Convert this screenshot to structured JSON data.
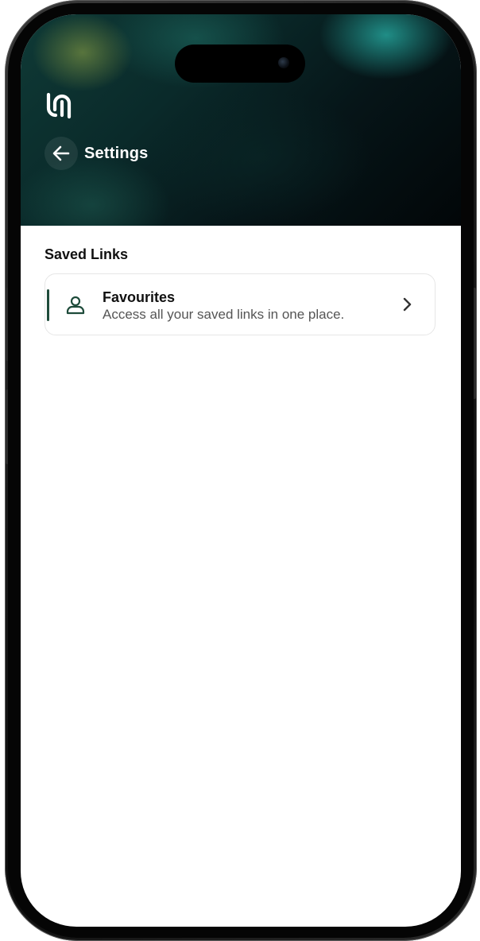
{
  "header": {
    "title": "Settings",
    "logo_icon": "app-logo-icon",
    "back_icon": "arrow-left-icon"
  },
  "section": {
    "title": "Saved Links"
  },
  "items": [
    {
      "title": "Favourites",
      "subtitle": "Access all your saved links in one place.",
      "icon": "user-icon",
      "trailing_icon": "chevron-right-icon"
    }
  ],
  "colors": {
    "accent": "#1e4b3a",
    "header_bg_dark": "#061518",
    "header_bg_teal": "#0f3a36"
  }
}
